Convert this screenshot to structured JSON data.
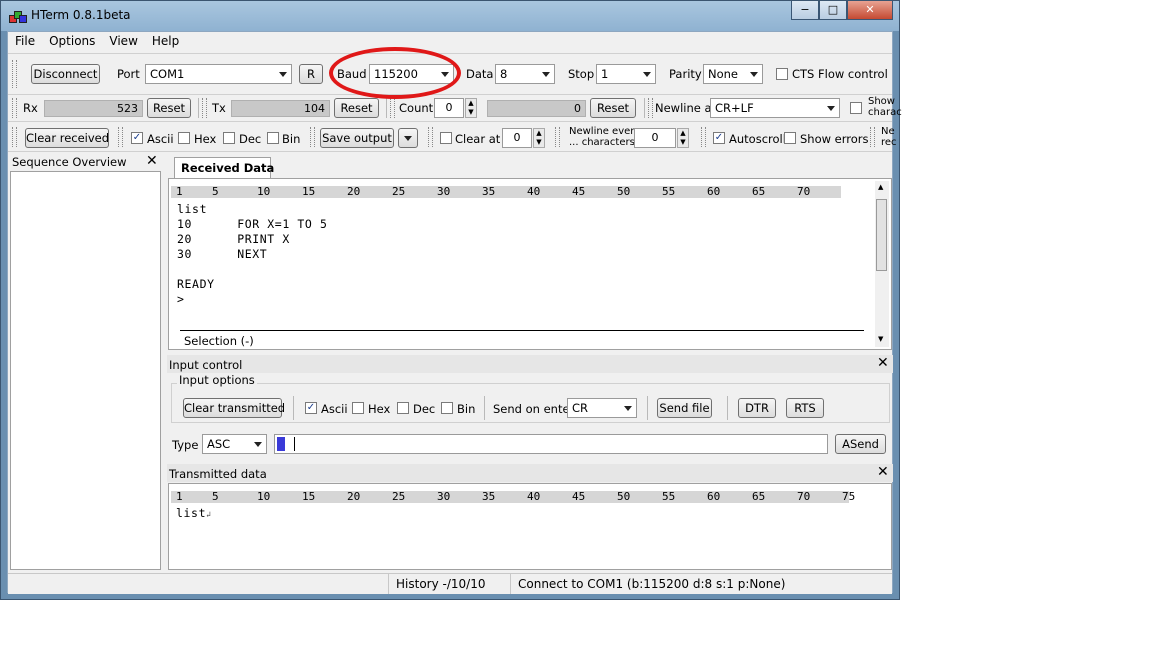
{
  "window": {
    "title": "HTerm 0.8.1beta",
    "min": "−",
    "max": "□",
    "close": "✕"
  },
  "menu": [
    "File",
    "Options",
    "View",
    "Help"
  ],
  "connection": {
    "disconnect_label": "Disconnect",
    "port_label": "Port",
    "port_value": "COM1",
    "refresh_label": "R",
    "baud_label": "Baud",
    "baud_value": "115200",
    "data_label": "Data",
    "data_value": "8",
    "stop_label": "Stop",
    "stop_value": "1",
    "parity_label": "Parity",
    "parity_value": "None",
    "cts_label": "CTS Flow control",
    "cts_checked": false
  },
  "counters": {
    "rx_label": "Rx",
    "rx_value": "523",
    "rx_reset": "Reset",
    "tx_label": "Tx",
    "tx_value": "104",
    "tx_reset": "Reset",
    "count_label": "Count",
    "count_value": "0",
    "count_field": "0",
    "count_reset": "Reset",
    "newline_label": "Newline at",
    "newline_value": "CR+LF",
    "show_label_1": "Show",
    "show_label_2": "charac"
  },
  "display_options": {
    "clear_received": "Clear received",
    "ascii": "Ascii",
    "hex": "Hex",
    "dec": "Dec",
    "bin": "Bin",
    "save_output": "Save output",
    "clear_at": "Clear at",
    "clear_at_value": "0",
    "newline_every_1": "Newline every",
    "newline_every_2": "... characters",
    "newline_every_value": "0",
    "autoscroll": "Autoscroll",
    "show_errors": "Show errors",
    "trunc_1": "Ne",
    "trunc_2": "rec"
  },
  "sequence": {
    "title": "Sequence Overview"
  },
  "received": {
    "tab": "Received Data",
    "ruler": [
      "1",
      "5",
      "10",
      "15",
      "20",
      "25",
      "30",
      "35",
      "40",
      "45",
      "50",
      "55",
      "60",
      "65",
      "70"
    ],
    "lines": [
      "list",
      "10      FOR X=1 TO 5",
      "20      PRINT X",
      "30      NEXT",
      "",
      "READY",
      ">"
    ],
    "selection": "Selection (-)"
  },
  "input_control": {
    "title": "Input control",
    "options_label": "Input options",
    "clear_transmitted": "Clear transmitted",
    "ascii": "Ascii",
    "hex": "Hex",
    "dec": "Dec",
    "bin": "Bin",
    "send_on_enter_label": "Send on enter",
    "send_on_enter_value": "CR",
    "send_file": "Send file",
    "dtr": "DTR",
    "rts": "RTS",
    "type_label": "Type",
    "type_value": "ASC",
    "send_button": "ASend"
  },
  "transmitted": {
    "title": "Transmitted data",
    "ruler": [
      "1",
      "5",
      "10",
      "15",
      "20",
      "25",
      "30",
      "35",
      "40",
      "45",
      "50",
      "55",
      "60",
      "65",
      "70",
      "75"
    ],
    "line": "list",
    "line_end": "↲"
  },
  "status": {
    "history": "History -/10/10",
    "connect": "Connect to COM1 (b:115200 d:8 s:1 p:None)"
  }
}
